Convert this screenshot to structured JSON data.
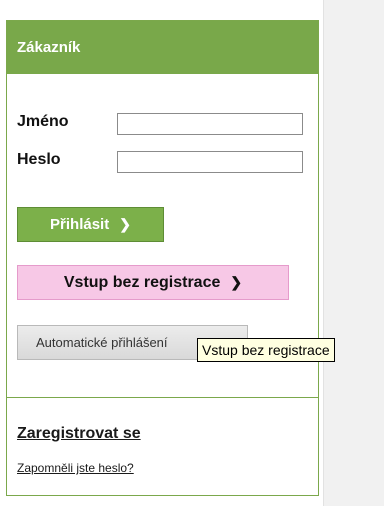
{
  "panel": {
    "title": "Zákazník",
    "name_label": "Jméno",
    "name_value": "",
    "password_label": "Heslo",
    "password_value": "",
    "login_button": "Přihlásit",
    "guest_button": "Vstup bez registrace",
    "auto_login_button": "Automatické přihlášení",
    "register_link": "Zaregistrovat se",
    "forgot_link": "Zapomněli jste heslo?"
  },
  "tooltip": {
    "text": "Vstup bez registrace"
  },
  "colors": {
    "header": "#79a84a",
    "login_button": "#7cb04a",
    "guest_button": "#f7c8e6"
  }
}
